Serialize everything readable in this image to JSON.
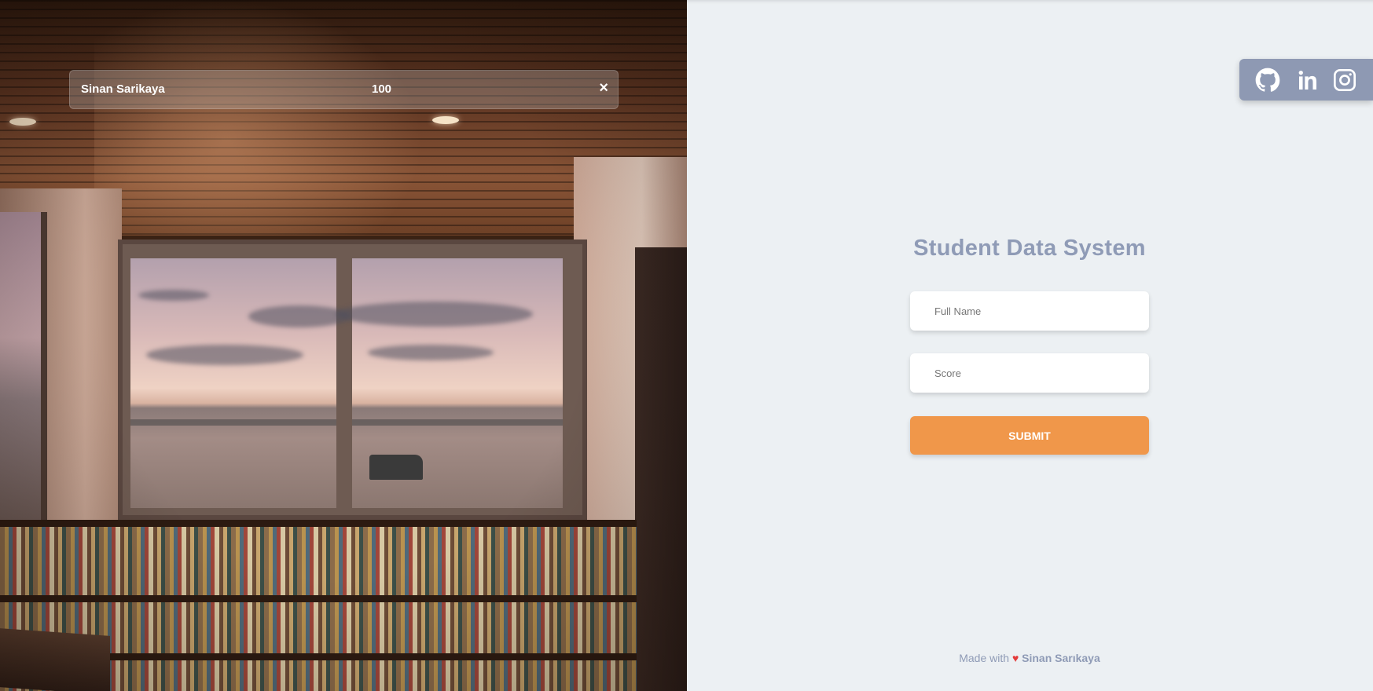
{
  "result": {
    "name": "Sinan Sarikaya",
    "score": "100",
    "close_label": "×"
  },
  "social": {
    "links": [
      {
        "name": "github",
        "icon": "github-icon"
      },
      {
        "name": "linkedin",
        "icon": "linkedin-icon"
      },
      {
        "name": "instagram",
        "icon": "instagram-icon"
      }
    ],
    "background": "#8e99b3"
  },
  "form": {
    "title": "Student Data System",
    "fullname_placeholder": "Full Name",
    "score_placeholder": "Score",
    "submit_label": "SUBMIT"
  },
  "footer": {
    "made_with": "Made with",
    "heart": "♥",
    "author": "Sinan Sarıkaya"
  },
  "colors": {
    "accent": "#f0974a",
    "title": "#8f9bb6",
    "background": "#ecf0f3"
  }
}
